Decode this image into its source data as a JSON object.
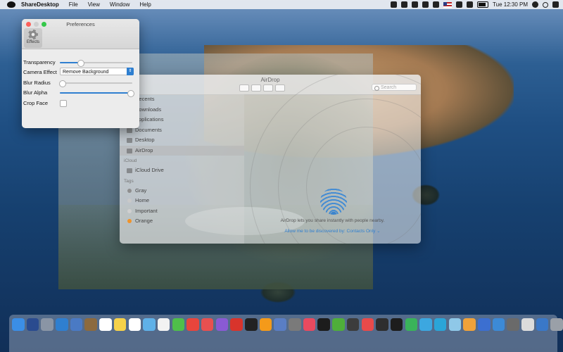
{
  "menubar": {
    "app_name": "ShareDesktop",
    "menus": [
      "File",
      "View",
      "Window",
      "Help"
    ],
    "clock": "Tue 12:30 PM"
  },
  "finder": {
    "title": "AirDrop",
    "search_placeholder": "Search",
    "sidebar": [
      {
        "label": "Recents",
        "type": "item"
      },
      {
        "label": "Downloads",
        "type": "item"
      },
      {
        "label": "Applications",
        "type": "item"
      },
      {
        "label": "Documents",
        "type": "item"
      },
      {
        "label": "Desktop",
        "type": "item"
      },
      {
        "label": "AirDrop",
        "type": "item",
        "selected": true
      },
      {
        "label": "iCloud",
        "type": "section"
      },
      {
        "label": "iCloud Drive",
        "type": "item"
      },
      {
        "label": "Tags",
        "type": "section"
      },
      {
        "label": "Gray",
        "type": "tag",
        "color": "#8e8e8e"
      },
      {
        "label": "Home",
        "type": "tag",
        "color": "#c9c9c9"
      },
      {
        "label": "Important",
        "type": "tag",
        "color": "#d0d0d0"
      },
      {
        "label": "Orange",
        "type": "tag",
        "color": "#f0932a"
      }
    ],
    "airdrop_text": "AirDrop lets you share instantly with people nearby.",
    "airdrop_link": "Allow me to be discovered by: Contacts Only ⌄"
  },
  "prefs": {
    "title": "Preferences",
    "tab_label": "Effects",
    "rows": {
      "transparency": {
        "label": "Transparency",
        "value": 0.28
      },
      "camera_effect": {
        "label": "Camera Effect",
        "value": "Remove Background"
      },
      "blur_radius": {
        "label": "Blur Radius",
        "value": 0.03
      },
      "blur_alpha": {
        "label": "Blur Alpha",
        "value": 0.97
      },
      "crop_face": {
        "label": "Crop Face",
        "checked": false
      }
    }
  },
  "dock": {
    "icon_colors": [
      "#3b8ee6",
      "#2a4b8f",
      "#8a95a5",
      "#2f7fd0",
      "#4a7ac4",
      "#8c6a3e",
      "#ffffff",
      "#f6d24a",
      "#ffffff",
      "#5fb1e8",
      "#f2f2f2",
      "#4fbf4a",
      "#e8453c",
      "#e85050",
      "#8a5ad4",
      "#d8342c",
      "#222222",
      "#f49a1a",
      "#5a7ec4",
      "#7a7a7a",
      "#e84a5f",
      "#1c1c1c",
      "#4fae3a",
      "#3c3c3c",
      "#e84a4a",
      "#2e2e2e",
      "#1d1d1d",
      "#3ab35a",
      "#3ca7e0",
      "#2aa5d8",
      "#8fc8e8",
      "#f0a23a",
      "#3c6fd0",
      "#3c8ad6",
      "#6a6a6a",
      "#dcdcdc",
      "#3a78c8",
      "#9aa0a8"
    ]
  }
}
